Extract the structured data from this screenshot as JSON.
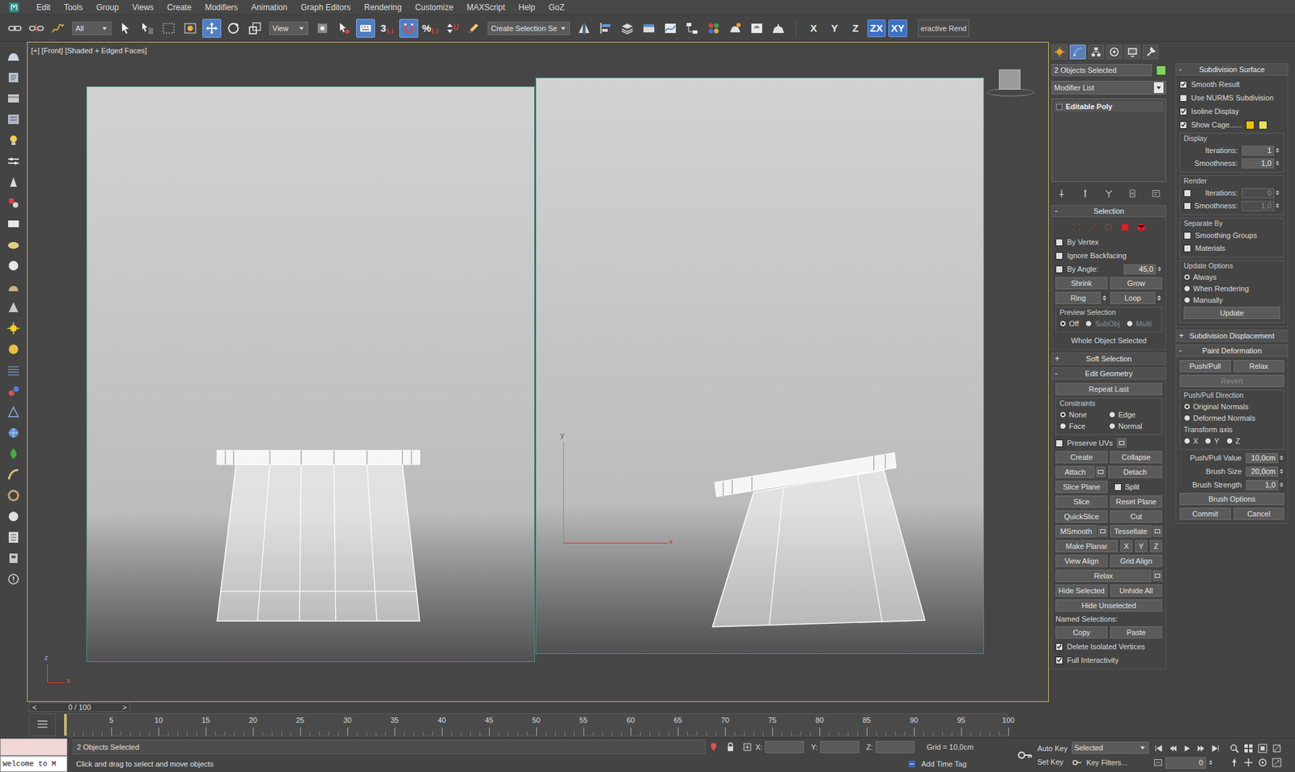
{
  "menu": [
    "Edit",
    "Tools",
    "Group",
    "Views",
    "Create",
    "Modifiers",
    "Animation",
    "Graph Editors",
    "Rendering",
    "Customize",
    "MAXScript",
    "Help",
    "GoZ"
  ],
  "toolbar": {
    "items": [
      {
        "kind": "link",
        "selected": false
      },
      {
        "kind": "unlink",
        "selected": false
      },
      {
        "kind": "bind",
        "selected": false
      },
      {
        "kind": "dropdown",
        "label": "All"
      },
      {
        "kind": "select",
        "selected": false
      },
      {
        "kind": "select-name",
        "selected": false
      },
      {
        "kind": "rect",
        "selected": false
      },
      {
        "kind": "window",
        "selected": false
      },
      {
        "kind": "move",
        "selected": true
      },
      {
        "kind": "rotate",
        "selected": false
      },
      {
        "kind": "scale",
        "selected": false
      },
      {
        "kind": "dropdown",
        "label": "View"
      },
      {
        "kind": "pivot",
        "selected": false
      },
      {
        "kind": "manipulate",
        "selected": false
      },
      {
        "kind": "override",
        "selected": true
      },
      {
        "kind": "snap",
        "label": "3",
        "selected": false
      },
      {
        "kind": "angle-snap",
        "selected": true
      },
      {
        "kind": "snap",
        "label": "%",
        "selected": false
      },
      {
        "kind": "spinner-snap",
        "selected": false
      },
      {
        "kind": "named-sel",
        "selected": false
      },
      {
        "kind": "dropdown",
        "label": "Create Selection Se"
      },
      {
        "kind": "mirror",
        "selected": false
      },
      {
        "kind": "align",
        "selected": false
      },
      {
        "kind": "layer",
        "selected": false
      },
      {
        "kind": "ribbon",
        "selected": false
      },
      {
        "kind": "curve",
        "selected": false
      },
      {
        "kind": "schematic",
        "selected": false
      },
      {
        "kind": "material",
        "selected": false
      },
      {
        "kind": "render-setup",
        "selected": false
      },
      {
        "kind": "frame-window",
        "selected": false
      },
      {
        "kind": "render",
        "selected": false
      }
    ],
    "axes": [
      {
        "label": "X",
        "selected": false
      },
      {
        "label": "Y",
        "selected": false
      },
      {
        "label": "Z",
        "selected": false
      },
      {
        "label": "ZX",
        "selected": true
      },
      {
        "label": "XY",
        "selected": true
      }
    ],
    "render_label": "eractive Rend"
  },
  "viewport": {
    "label": "[+] [Front] [Shaded + Edged Faces]",
    "axis_labels": [
      "y",
      "x"
    ],
    "world_axis_labels": [
      "z",
      "x"
    ]
  },
  "timeline": {
    "prev": "<",
    "frame": "0 / 100",
    "next": ">",
    "level": 0,
    "ticks": [
      "5",
      "10",
      "15",
      "20",
      "25",
      "30",
      "35",
      "40",
      "45",
      "50",
      "55",
      "60",
      "65",
      "70",
      "75",
      "80",
      "85",
      "90",
      "95",
      "100"
    ]
  },
  "command_panel": {
    "tabs": [
      {
        "kind": "create",
        "selected": false
      },
      {
        "kind": "modify",
        "selected": true
      },
      {
        "kind": "hierarchy",
        "selected": false
      },
      {
        "kind": "motion",
        "selected": false
      },
      {
        "kind": "display",
        "selected": false
      },
      {
        "kind": "utilities",
        "selected": false
      }
    ],
    "object_name": "2 Objects Selected",
    "modifier_list": "Modifier List",
    "stack": [
      {
        "label": "Editable Poly",
        "selected": false
      }
    ],
    "left": [
      {
        "title": "Selection",
        "sign": "-",
        "expanded": true,
        "items": [
          {
            "kind": "subobjects",
            "items": [
              {
                "enabled": false
              },
              {
                "enabled": false
              },
              {
                "enabled": false
              },
              {
                "enabled": true
              },
              {
                "enabled": true
              }
            ]
          },
          {
            "kind": "check",
            "label": "By Vertex",
            "checked": false
          },
          {
            "kind": "check",
            "label": "Ignore Backfacing",
            "checked": false
          },
          {
            "kind": "check-value",
            "label": "By Angle:",
            "checked": false,
            "value": "45,0"
          },
          {
            "kind": "buttons",
            "items": [
              {
                "kind": "button",
                "label": "Shrink"
              },
              {
                "kind": "button",
                "label": "Grow"
              }
            ]
          },
          {
            "kind": "buttons",
            "items": [
              {
                "kind": "spin",
                "label": "Ring"
              },
              {
                "kind": "spin",
                "label": "Loop"
              }
            ]
          },
          {
            "kind": "group",
            "title": "Preview Selection",
            "items": [
              {
                "kind": "radio-row",
                "options": [
                  {
                    "label": "Off",
                    "selected": true,
                    "disabled": false
                  },
                  {
                    "label": "SubObj",
                    "selected": false,
                    "disabled": true
                  },
                  {
                    "label": "Multi",
                    "selected": false,
                    "disabled": true
                  }
                ]
              }
            ]
          },
          {
            "kind": "info",
            "label": "Whole Object Selected"
          }
        ]
      },
      {
        "title": "Soft Selection",
        "sign": "+",
        "expanded": false,
        "items": []
      },
      {
        "title": "Edit Geometry",
        "sign": "-",
        "expanded": true,
        "items": [
          {
            "kind": "buttons",
            "items": [
              {
                "kind": "button",
                "label": "Repeat Last"
              }
            ]
          },
          {
            "kind": "group",
            "title": "Constraints",
            "items": [
              {
                "kind": "radio-grid",
                "options": [
                  {
                    "label": "None",
                    "selected": true,
                    "disabled": false
                  },
                  {
                    "label": "Edge",
                    "selected": false,
                    "disabled": false
                  },
                  {
                    "label": "Face",
                    "selected": false,
                    "disabled": false
                  },
                  {
                    "label": "Normal",
                    "selected": false,
                    "disabled": false
                  }
                ]
              }
            ]
          },
          {
            "kind": "check-settings",
            "label": "Preserve UVs",
            "checked": false
          },
          {
            "kind": "buttons",
            "items": [
              {
                "kind": "button",
                "label": "Create"
              },
              {
                "kind": "button",
                "label": "Collapse"
              }
            ]
          },
          {
            "kind": "buttons",
            "items": [
              {
                "kind": "settings",
                "label": "Attach"
              },
              {
                "kind": "button",
                "label": "Detach"
              }
            ]
          },
          {
            "kind": "buttons",
            "items": [
              {
                "kind": "button",
                "label": "Slice Plane"
              },
              {
                "kind": "check",
                "label": "Split",
                "checked": false
              }
            ]
          },
          {
            "kind": "buttons",
            "items": [
              {
                "kind": "button",
                "label": "Slice"
              },
              {
                "kind": "button",
                "label": "Reset Plane"
              }
            ]
          },
          {
            "kind": "buttons",
            "items": [
              {
                "kind": "button",
                "label": "QuickSlice"
              },
              {
                "kind": "button",
                "label": "Cut"
              }
            ]
          },
          {
            "kind": "buttons",
            "items": [
              {
                "kind": "settings",
                "label": "MSmooth"
              },
              {
                "kind": "settings",
                "label": "Tessellate"
              }
            ]
          },
          {
            "kind": "buttons",
            "items": [
              {
                "kind": "button",
                "label": "Make Planar"
              },
              {
                "kind": "axis",
                "label": "X"
              },
              {
                "kind": "axis",
                "label": "Y"
              },
              {
                "kind": "axis",
                "label": "Z"
              }
            ]
          },
          {
            "kind": "buttons",
            "items": [
              {
                "kind": "button",
                "label": "View Align"
              },
              {
                "kind": "button",
                "label": "Grid Align"
              }
            ]
          },
          {
            "kind": "buttons",
            "items": [
              {
                "kind": "settings",
                "label": "Relax"
              }
            ]
          },
          {
            "kind": "buttons",
            "items": [
              {
                "kind": "button",
                "label": "Hide Selected"
              },
              {
                "kind": "button",
                "label": "Unhide All"
              }
            ]
          },
          {
            "kind": "buttons",
            "items": [
              {
                "kind": "button",
                "label": "Hide Unselected"
              }
            ]
          },
          {
            "kind": "label",
            "label": "Named Selections:"
          },
          {
            "kind": "buttons",
            "items": [
              {
                "kind": "button",
                "label": "Copy"
              },
              {
                "kind": "button",
                "label": "Paste"
              }
            ]
          },
          {
            "kind": "check",
            "label": "Delete Isolated Vertices",
            "checked": true
          },
          {
            "kind": "check",
            "label": "Full Interactivity",
            "checked": true
          }
        ]
      }
    ],
    "right": [
      {
        "title": "Subdivision Surface",
        "sign": "-",
        "expanded": true,
        "items": [
          {
            "kind": "check",
            "label": "Smooth Result",
            "checked": true
          },
          {
            "kind": "check",
            "label": "Use NURMS Subdivision",
            "checked": false
          },
          {
            "kind": "check",
            "label": "Isoline Display",
            "checked": true
          },
          {
            "kind": "check-swatches",
            "label": "Show Cage......",
            "checked": true,
            "colors": [
              "#f2c200",
              "#e6e35a"
            ]
          },
          {
            "kind": "group",
            "title": "Display",
            "items": [
              {
                "kind": "spinner",
                "label": "Iterations:",
                "value": "1"
              },
              {
                "kind": "spinner",
                "label": "Smoothness:",
                "value": "1,0"
              }
            ]
          },
          {
            "kind": "group",
            "title": "Render",
            "items": [
              {
                "kind": "check-spinner",
                "label": "Iterations:",
                "value": "0",
                "checked": false,
                "disabled": true
              },
              {
                "kind": "check-spinner",
                "label": "Smoothness:",
                "value": "1,0",
                "checked": false,
                "disabled": true
              }
            ]
          },
          {
            "kind": "group",
            "title": "Separate By",
            "items": [
              {
                "kind": "check",
                "label": "Smoothing Groups",
                "checked": false
              },
              {
                "kind": "check",
                "label": "Materials",
                "checked": false
              }
            ]
          },
          {
            "kind": "group",
            "title": "Update Options",
            "items": [
              {
                "kind": "radio-col",
                "options": [
                  {
                    "label": "Always",
                    "selected": true,
                    "disabled": false
                  },
                  {
                    "label": "When Rendering",
                    "selected": false,
                    "disabled": false
                  },
                  {
                    "label": "Manually",
                    "selected": false,
                    "disabled": false
                  }
                ]
              },
              {
                "kind": "buttons",
                "items": [
                  {
                    "kind": "button",
                    "label": "Update"
                  }
                ]
              }
            ]
          }
        ]
      },
      {
        "title": "Subdivision Displacement",
        "sign": "+",
        "expanded": false,
        "items": []
      },
      {
        "title": "Paint Deformation",
        "sign": "-",
        "expanded": true,
        "items": [
          {
            "kind": "buttons",
            "items": [
              {
                "kind": "button",
                "label": "Push/Pull"
              },
              {
                "kind": "button",
                "label": "Relax"
              }
            ]
          },
          {
            "kind": "buttons",
            "items": [
              {
                "kind": "plain",
                "label": "Revert",
                "disabled": true
              }
            ]
          },
          {
            "kind": "group",
            "title": "Push/Pull Direction",
            "items": [
              {
                "kind": "radio-col",
                "options": [
                  {
                    "label": "Original Normals",
                    "selected": true,
                    "disabled": false
                  },
                  {
                    "label": "Deformed Normals",
                    "selected": false,
                    "disabled": false
                  }
                ]
              },
              {
                "kind": "label",
                "label": "Transform axis"
              },
              {
                "kind": "radio-row",
                "options": [
                  {
                    "label": "X",
                    "selected": false,
                    "disabled": false
                  },
                  {
                    "label": "Y",
                    "selected": false,
                    "disabled": false
                  },
                  {
                    "label": "Z",
                    "selected": false,
                    "disabled": false
                  }
                ]
              }
            ]
          },
          {
            "kind": "spinner",
            "label": "Push/Pull Value",
            "value": "10,0cm"
          },
          {
            "kind": "spinner",
            "label": "Brush Size",
            "value": "20,0cm"
          },
          {
            "kind": "spinner",
            "label": "Brush Strength",
            "value": "1,0"
          },
          {
            "kind": "buttons",
            "items": [
              {
                "kind": "plain",
                "label": "Brush Options"
              }
            ]
          },
          {
            "kind": "buttons",
            "items": [
              {
                "kind": "button",
                "label": "Commit"
              },
              {
                "kind": "button",
                "label": "Cancel"
              }
            ]
          }
        ]
      }
    ]
  },
  "status": {
    "listener": "Welcome to M",
    "selection": "2 Objects Selected",
    "prompt": "Click and drag to select and move objects",
    "coords": [
      "X:",
      "Y:",
      "Z:"
    ],
    "grid": "Grid = 10,0cm",
    "time_tag": "Add Time Tag",
    "auto_key": "Auto Key",
    "key_mode": "Selected",
    "set_key": "Set Key",
    "key_filters": "Key Filters...",
    "frame": "0"
  }
}
